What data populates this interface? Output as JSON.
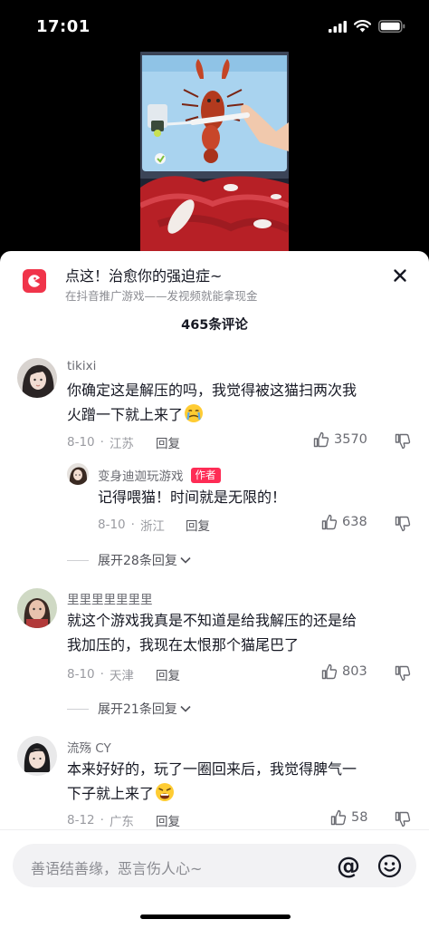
{
  "status_bar": {
    "time": "17:01"
  },
  "ad": {
    "title": "点这！治愈你的强迫症~",
    "subtitle": "在抖音推广游戏——发视频就能拿现金"
  },
  "comments_header": {
    "count_label": "465条评论"
  },
  "comments": [
    {
      "author": "tikixi",
      "text_line1": "你确定这是解压的吗，我觉得被这猫扫两次我",
      "text_line2": "火蹭一下就上来了",
      "date": "8-10",
      "location": "江苏",
      "reply_label": "回复",
      "likes": "3570",
      "reply": {
        "author": "变身迪迦玩游戏",
        "badge": "作者",
        "text": "记得喂猫！时间就是无限的！",
        "date": "8-10",
        "location": "浙江",
        "reply_label": "回复",
        "likes": "638"
      },
      "expand_label": "展开28条回复"
    },
    {
      "author": "里里里里里里里",
      "text_line1": "就这个游戏我真是不知道是给我解压的还是给",
      "text_line2": "我加压的，我现在太恨那个猫尾巴了",
      "date": "8-10",
      "location": "天津",
      "reply_label": "回复",
      "likes": "803",
      "expand_label": "展开21条回复"
    },
    {
      "author": "流殇 CY",
      "text_line1": "本来好好的，玩了一圈回来后，我觉得脾气一",
      "text_line2": "下子就上来了",
      "date": "8-12",
      "location": "广东",
      "reply_label": "回复",
      "likes": "58"
    }
  ],
  "input": {
    "placeholder": "善语结善缘，恶言伤人心~",
    "at_symbol": "@"
  },
  "colors": {
    "accent": "#fe2c55",
    "ad_logo": "#f0344a",
    "text": "#161823",
    "muted": "#8a8b91"
  }
}
